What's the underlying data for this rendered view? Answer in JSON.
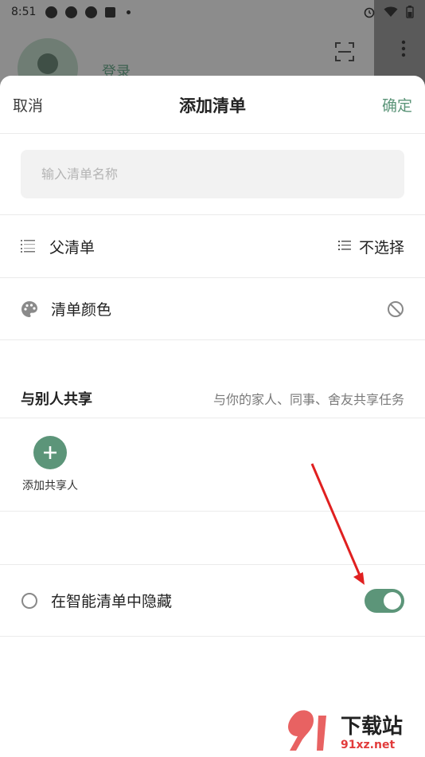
{
  "status_bar": {
    "time": "8:51"
  },
  "background_app": {
    "login_label": "登录"
  },
  "sheet": {
    "cancel_label": "取消",
    "title": "添加清单",
    "confirm_label": "确定",
    "name_input": {
      "placeholder": "输入清单名称",
      "value": ""
    },
    "parent_list": {
      "label": "父清单",
      "value": "不选择",
      "icon": "list-icon"
    },
    "list_color": {
      "label": "清单颜色",
      "icon": "palette-icon",
      "value_icon": "no-color-icon"
    },
    "share": {
      "title": "与别人共享",
      "description": "与你的家人、同事、舍友共享任务",
      "add_label": "添加共享人"
    },
    "hide_in_smart": {
      "label": "在智能清单中隐藏",
      "icon": "moon-icon",
      "enabled": true
    }
  },
  "watermark": {
    "big": "下载站",
    "small": "91xz.net"
  },
  "colors": {
    "accent": "#5c9579",
    "arrow": "#e02020"
  }
}
